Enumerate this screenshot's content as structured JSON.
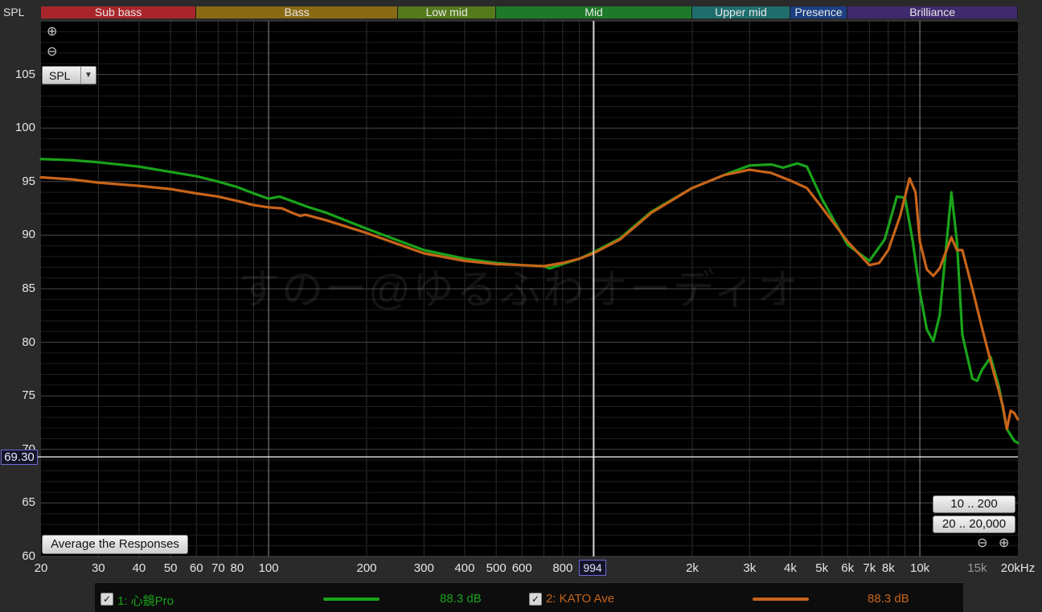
{
  "app": {
    "y_axis_title": "SPL",
    "y_unit_select": "SPL",
    "watermark": "すのー@ゆるふわオーディオ"
  },
  "bands": [
    {
      "label": "Sub bass",
      "f0": 20,
      "f1": 60,
      "color": "#a8262b"
    },
    {
      "label": "Bass",
      "f0": 60,
      "f1": 250,
      "color": "#8a6a14"
    },
    {
      "label": "Low mid",
      "f0": 250,
      "f1": 500,
      "color": "#557a1c"
    },
    {
      "label": "Mid",
      "f0": 500,
      "f1": 2000,
      "color": "#1e7a2a"
    },
    {
      "label": "Upper mid",
      "f0": 2000,
      "f1": 4000,
      "color": "#1f6e6e"
    },
    {
      "label": "Presence",
      "f0": 4000,
      "f1": 6000,
      "color": "#1c3f82"
    },
    {
      "label": "Brilliance",
      "f0": 6000,
      "f1": 20000,
      "color": "#3f2a6e"
    }
  ],
  "zoom": {
    "in_icon": "zoom-in-icon",
    "out_icon": "zoom-out-icon"
  },
  "buttons": {
    "average": "Average the Responses",
    "range_10_200": "10 .. 200",
    "range_20_20000": "20 .. 20,000"
  },
  "cursor": {
    "y_readout": "69.30",
    "x_readout": "994"
  },
  "legend": [
    {
      "index_name": "1: 心鏡Pro",
      "level": "88.3 dB",
      "color": "#1aa31a"
    },
    {
      "index_name": "2: KATO Ave",
      "level": "88.3 dB",
      "color": "#c8641a"
    }
  ],
  "chart_data": {
    "type": "line",
    "x_scale": "log",
    "xlim": [
      20,
      20000
    ],
    "ylim": [
      60,
      110
    ],
    "y_ticks": [
      60,
      65,
      70,
      75,
      80,
      85,
      90,
      95,
      100,
      105
    ],
    "x_ticks": [
      {
        "v": 20,
        "label": "20"
      },
      {
        "v": 30,
        "label": "30"
      },
      {
        "v": 40,
        "label": "40"
      },
      {
        "v": 50,
        "label": "50"
      },
      {
        "v": 60,
        "label": "60"
      },
      {
        "v": 70,
        "label": "70"
      },
      {
        "v": 80,
        "label": "80"
      },
      {
        "v": 100,
        "label": "100"
      },
      {
        "v": 200,
        "label": "200"
      },
      {
        "v": 300,
        "label": "300"
      },
      {
        "v": 400,
        "label": "400"
      },
      {
        "v": 500,
        "label": "500"
      },
      {
        "v": 600,
        "label": "600"
      },
      {
        "v": 800,
        "label": "800"
      },
      {
        "v": 2000,
        "label": "2k"
      },
      {
        "v": 3000,
        "label": "3k"
      },
      {
        "v": 4000,
        "label": "4k"
      },
      {
        "v": 5000,
        "label": "5k"
      },
      {
        "v": 6000,
        "label": "6k"
      },
      {
        "v": 7000,
        "label": "7k"
      },
      {
        "v": 8000,
        "label": "8k"
      },
      {
        "v": 10000,
        "label": "10k"
      },
      {
        "v": 15000,
        "label": "15k",
        "dim": true
      },
      {
        "v": 20000,
        "label": "20kHz"
      }
    ],
    "cursor": {
      "x": 994,
      "y": 69.3
    },
    "series": [
      {
        "name": "1: 心鏡Pro",
        "color": "#1aa31a",
        "points": [
          [
            20,
            97.1
          ],
          [
            25,
            97.0
          ],
          [
            30,
            96.8
          ],
          [
            40,
            96.4
          ],
          [
            50,
            95.9
          ],
          [
            60,
            95.5
          ],
          [
            70,
            95.0
          ],
          [
            80,
            94.5
          ],
          [
            90,
            93.9
          ],
          [
            100,
            93.4
          ],
          [
            108,
            93.6
          ],
          [
            120,
            93.1
          ],
          [
            130,
            92.7
          ],
          [
            150,
            92.1
          ],
          [
            200,
            90.6
          ],
          [
            300,
            88.6
          ],
          [
            400,
            87.8
          ],
          [
            500,
            87.4
          ],
          [
            600,
            87.2
          ],
          [
            700,
            87.1
          ],
          [
            730,
            86.9
          ],
          [
            800,
            87.3
          ],
          [
            900,
            87.8
          ],
          [
            994,
            88.4
          ],
          [
            1200,
            89.7
          ],
          [
            1500,
            92.2
          ],
          [
            2000,
            94.4
          ],
          [
            2500,
            95.6
          ],
          [
            3000,
            96.5
          ],
          [
            3500,
            96.6
          ],
          [
            3800,
            96.3
          ],
          [
            4200,
            96.7
          ],
          [
            4500,
            96.4
          ],
          [
            5000,
            93.4
          ],
          [
            6000,
            89.1
          ],
          [
            7000,
            87.6
          ],
          [
            7800,
            89.6
          ],
          [
            8500,
            93.6
          ],
          [
            9000,
            93.5
          ],
          [
            9500,
            89.5
          ],
          [
            10000,
            84.7
          ],
          [
            10500,
            81.2
          ],
          [
            11000,
            80.1
          ],
          [
            11500,
            82.5
          ],
          [
            12000,
            88.4
          ],
          [
            12500,
            94.0
          ],
          [
            13000,
            89.4
          ],
          [
            13500,
            80.7
          ],
          [
            14500,
            76.6
          ],
          [
            15000,
            76.4
          ],
          [
            15500,
            77.4
          ],
          [
            16500,
            78.6
          ],
          [
            17500,
            75.8
          ],
          [
            18500,
            71.9
          ],
          [
            19500,
            70.8
          ],
          [
            20000,
            70.6
          ]
        ]
      },
      {
        "name": "2: KATO Ave",
        "color": "#c8641a",
        "points": [
          [
            20,
            95.4
          ],
          [
            25,
            95.2
          ],
          [
            30,
            94.9
          ],
          [
            40,
            94.6
          ],
          [
            50,
            94.3
          ],
          [
            60,
            93.9
          ],
          [
            70,
            93.6
          ],
          [
            80,
            93.2
          ],
          [
            90,
            92.8
          ],
          [
            100,
            92.6
          ],
          [
            110,
            92.5
          ],
          [
            120,
            92.0
          ],
          [
            125,
            91.8
          ],
          [
            130,
            91.9
          ],
          [
            150,
            91.4
          ],
          [
            200,
            90.2
          ],
          [
            300,
            88.3
          ],
          [
            400,
            87.6
          ],
          [
            500,
            87.3
          ],
          [
            600,
            87.2
          ],
          [
            700,
            87.1
          ],
          [
            800,
            87.4
          ],
          [
            900,
            87.8
          ],
          [
            994,
            88.3
          ],
          [
            1200,
            89.6
          ],
          [
            1500,
            92.1
          ],
          [
            2000,
            94.4
          ],
          [
            2500,
            95.6
          ],
          [
            3000,
            96.1
          ],
          [
            3500,
            95.8
          ],
          [
            4000,
            95.1
          ],
          [
            4500,
            94.4
          ],
          [
            5000,
            92.6
          ],
          [
            6000,
            89.4
          ],
          [
            7000,
            87.2
          ],
          [
            7500,
            87.4
          ],
          [
            8000,
            88.6
          ],
          [
            8700,
            91.8
          ],
          [
            9300,
            95.3
          ],
          [
            9700,
            94.0
          ],
          [
            10000,
            89.4
          ],
          [
            10500,
            86.8
          ],
          [
            11000,
            86.2
          ],
          [
            11500,
            86.9
          ],
          [
            12500,
            89.8
          ],
          [
            13000,
            88.6
          ],
          [
            13500,
            88.6
          ],
          [
            14500,
            85.0
          ],
          [
            15500,
            81.4
          ],
          [
            16500,
            78.2
          ],
          [
            17500,
            75.4
          ],
          [
            18000,
            74.0
          ],
          [
            18500,
            71.9
          ],
          [
            19000,
            73.6
          ],
          [
            19500,
            73.4
          ],
          [
            20000,
            72.8
          ]
        ]
      }
    ]
  }
}
